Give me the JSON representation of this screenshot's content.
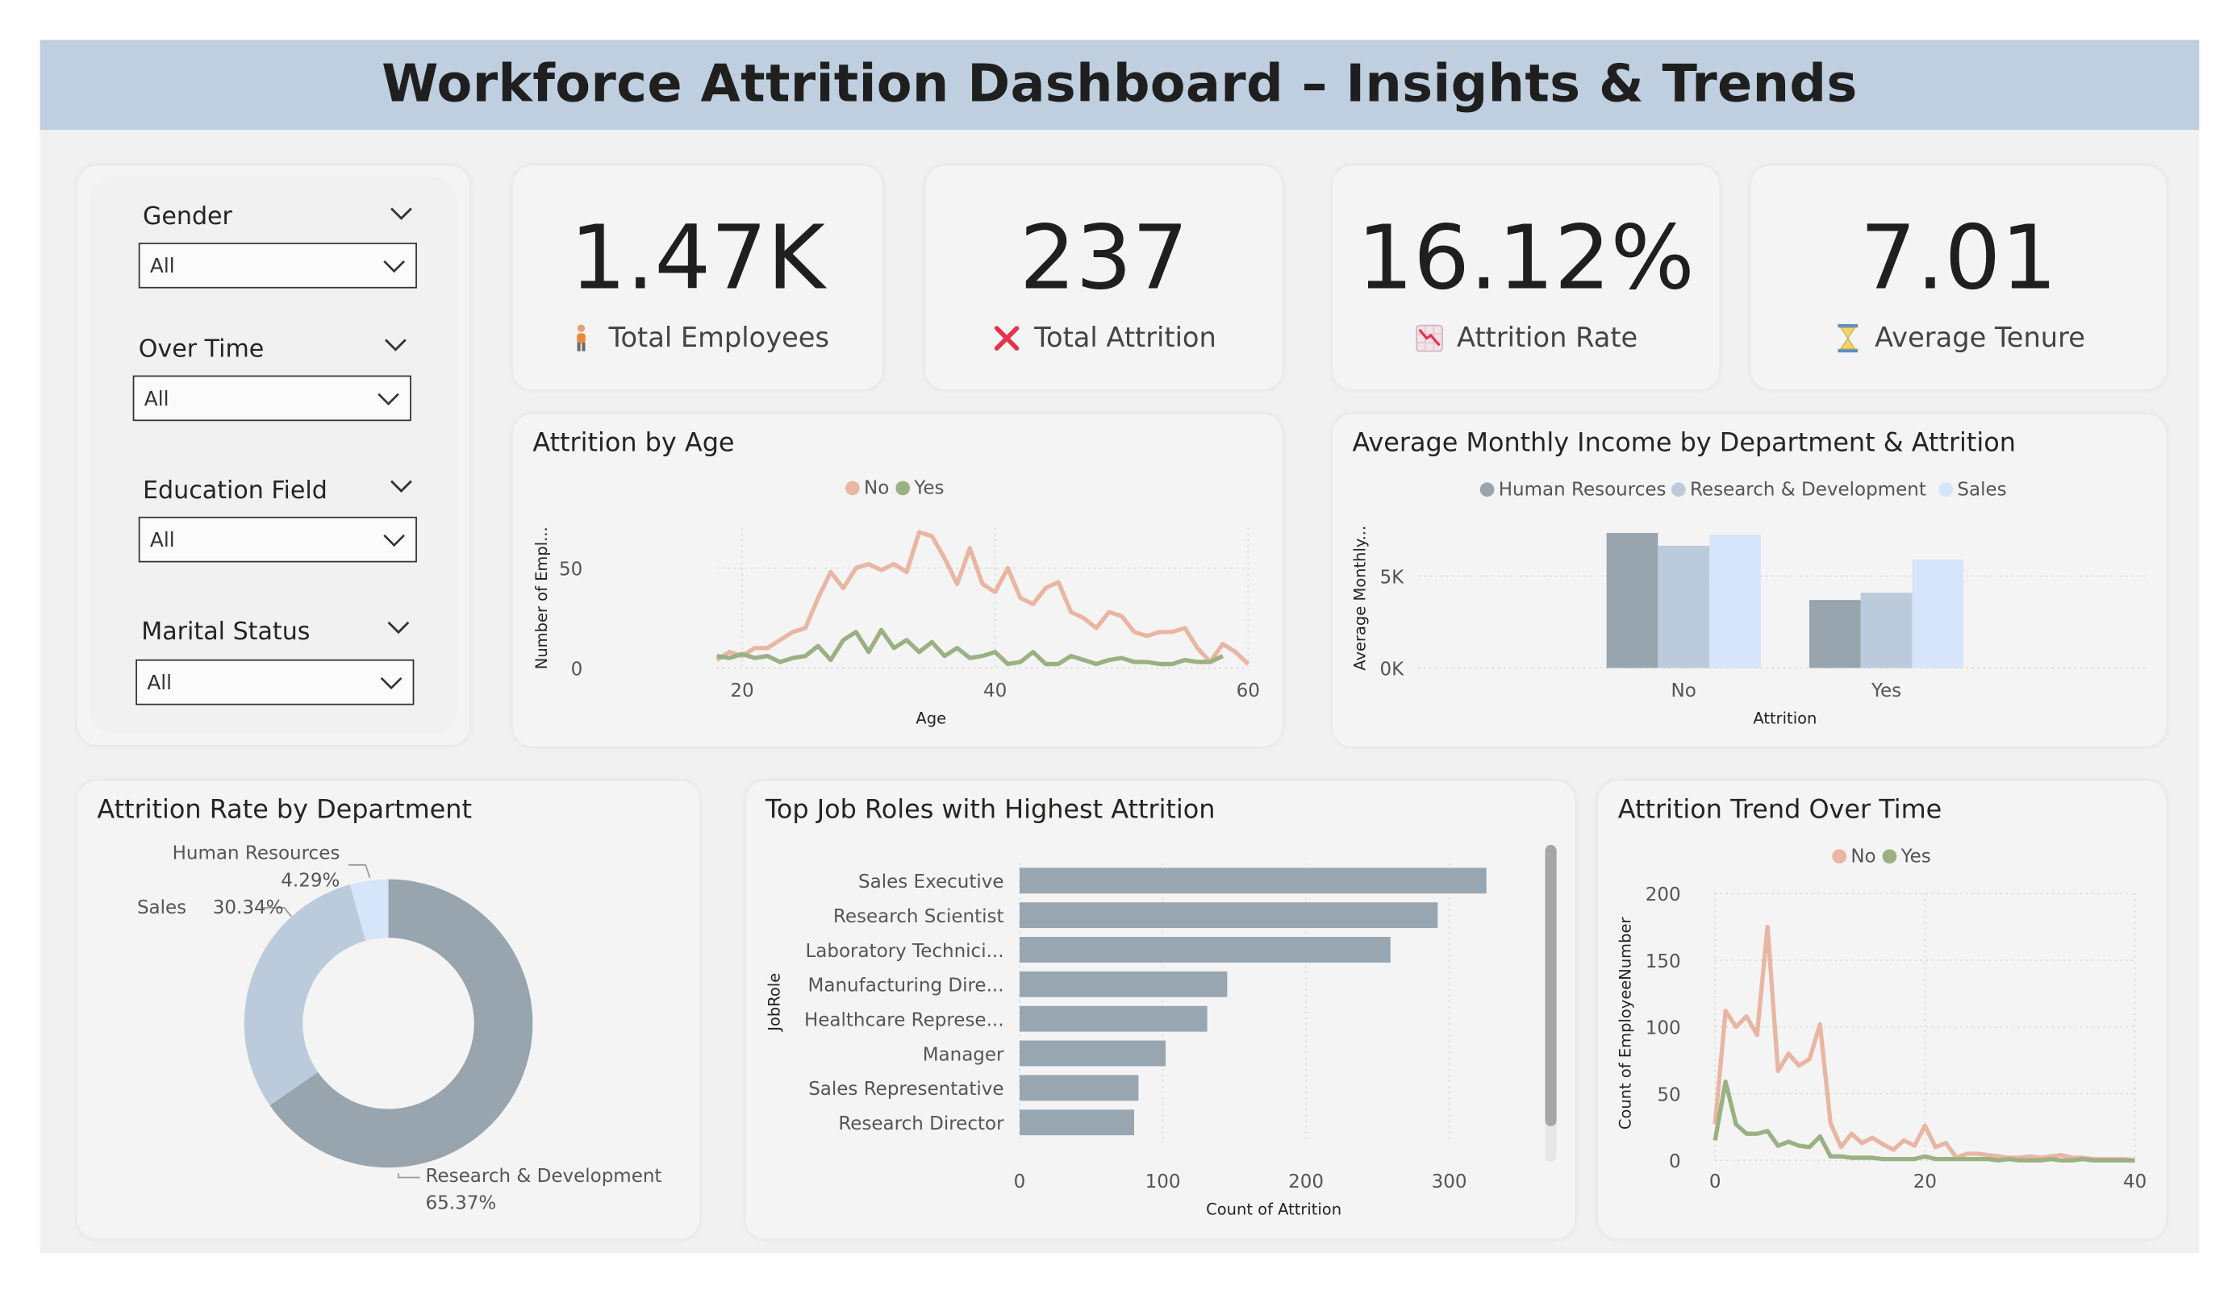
{
  "title": "Workforce Attrition Dashboard – Insights & Trends",
  "slicers": [
    {
      "label": "Gender",
      "value": "All"
    },
    {
      "label": "Over Time",
      "value": "All"
    },
    {
      "label": "Education Field",
      "value": "All"
    },
    {
      "label": "Marital Status",
      "value": "All"
    }
  ],
  "kpis": [
    {
      "value": "1.47K",
      "label": "Total Employees",
      "icon": "person-icon"
    },
    {
      "value": "237",
      "label": "Total Attrition",
      "icon": "cross-icon"
    },
    {
      "value": "16.12%",
      "label": "Attrition Rate",
      "icon": "chart-down-icon"
    },
    {
      "value": "7.01",
      "label": "Average Tenure",
      "icon": "hourglass-icon"
    }
  ],
  "colors": {
    "no": "#e8b6a2",
    "yes": "#9bb083",
    "hr": "#98a4ae",
    "rnd": "#bccbdb",
    "sales": "#d6e5f9",
    "bar": "#98a6b1",
    "cross": "#e6324b"
  },
  "chart_data": [
    {
      "id": "age",
      "type": "line",
      "title": "Attrition by Age",
      "xlabel": "Age",
      "ylabel": "Number of Empl...",
      "xlim": [
        18,
        60
      ],
      "ylim": [
        0,
        70
      ],
      "xticks": [
        "20",
        "40",
        "60"
      ],
      "yticks": [
        "0",
        "50"
      ],
      "legend": "top",
      "series": [
        {
          "name": "No",
          "color": "#e8b6a2",
          "x": [
            18,
            19,
            20,
            21,
            22,
            23,
            24,
            25,
            26,
            27,
            28,
            29,
            30,
            31,
            32,
            33,
            34,
            35,
            36,
            37,
            38,
            39,
            40,
            41,
            42,
            43,
            44,
            45,
            46,
            47,
            48,
            49,
            50,
            51,
            52,
            53,
            54,
            55,
            56,
            57,
            58,
            59,
            60
          ],
          "y": [
            4,
            8,
            6,
            10,
            10,
            14,
            18,
            20,
            35,
            48,
            40,
            50,
            52,
            49,
            52,
            48,
            68,
            66,
            55,
            42,
            60,
            42,
            38,
            50,
            35,
            32,
            40,
            43,
            28,
            25,
            20,
            28,
            26,
            18,
            16,
            18,
            18,
            20,
            10,
            3,
            12,
            8,
            2
          ]
        },
        {
          "name": "Yes",
          "color": "#9bb083",
          "x": [
            18,
            19,
            20,
            21,
            22,
            23,
            24,
            25,
            26,
            27,
            28,
            29,
            30,
            31,
            32,
            33,
            34,
            35,
            36,
            37,
            38,
            39,
            40,
            41,
            42,
            43,
            44,
            45,
            46,
            47,
            48,
            49,
            50,
            51,
            52,
            53,
            54,
            55,
            56,
            57,
            58
          ],
          "y": [
            6,
            5,
            7,
            5,
            6,
            3,
            5,
            6,
            11,
            4,
            14,
            18,
            8,
            19,
            10,
            14,
            8,
            13,
            6,
            10,
            5,
            6,
            8,
            2,
            3,
            8,
            2,
            2,
            6,
            4,
            2,
            4,
            5,
            3,
            3,
            2,
            2,
            4,
            3,
            3,
            6
          ]
        }
      ]
    },
    {
      "id": "income",
      "type": "bar",
      "title": "Average Monthly Income by Department & Attrition",
      "xlabel": "Attrition",
      "ylabel": "Average Monthly...",
      "categories": [
        "No",
        "Yes"
      ],
      "ylim": [
        0,
        8000
      ],
      "yticks": [
        "0K",
        "5K"
      ],
      "legend": "top",
      "series": [
        {
          "name": "Human Resources",
          "color": "#98a4ae",
          "values": [
            7350,
            3700
          ]
        },
        {
          "name": "Research & Development",
          "color": "#bccbdb",
          "values": [
            6650,
            4100
          ]
        },
        {
          "name": "Sales",
          "color": "#d6e5f9",
          "values": [
            7250,
            5900
          ]
        }
      ]
    },
    {
      "id": "dept",
      "type": "pie",
      "title": "Attrition Rate by Department",
      "slices": [
        {
          "name": "Research & Development",
          "value": 65.37,
          "label": "65.37%",
          "color": "#98a4ae"
        },
        {
          "name": "Sales",
          "value": 30.34,
          "label": "30.34%",
          "color": "#bccbdb"
        },
        {
          "name": "Human Resources",
          "value": 4.29,
          "label": "4.29%",
          "color": "#d6e5f9"
        }
      ]
    },
    {
      "id": "roles",
      "type": "bar",
      "orientation": "horizontal",
      "title": "Top Job Roles with Highest Attrition",
      "xlabel": "Count of Attrition",
      "ylabel": "JobRole",
      "xlim": [
        0,
        360
      ],
      "xticks": [
        "0",
        "100",
        "200",
        "300"
      ],
      "categories": [
        "Sales Executive",
        "Research Scientist",
        "Laboratory Technici...",
        "Manufacturing Dire...",
        "Healthcare Represe...",
        "Manager",
        "Sales Representative",
        "Research Director"
      ],
      "values": [
        326,
        292,
        259,
        145,
        131,
        102,
        83,
        80
      ]
    },
    {
      "id": "trend",
      "type": "line",
      "title": "Attrition Trend Over Time",
      "xlabel": "",
      "ylabel": "Count of EmployeeNumber",
      "xlim": [
        0,
        40
      ],
      "ylim": [
        0,
        200
      ],
      "xticks": [
        "0",
        "20",
        "40"
      ],
      "yticks": [
        "0",
        "50",
        "100",
        "150",
        "200"
      ],
      "legend": "top",
      "series": [
        {
          "name": "No",
          "color": "#e8b6a2",
          "x": [
            0,
            1,
            2,
            3,
            4,
            5,
            6,
            7,
            8,
            9,
            10,
            11,
            12,
            13,
            14,
            15,
            16,
            17,
            18,
            19,
            20,
            21,
            22,
            23,
            24,
            25,
            26,
            27,
            28,
            29,
            30,
            31,
            32,
            33,
            34,
            35,
            36,
            37,
            38,
            39,
            40
          ],
          "y": [
            27,
            112,
            100,
            108,
            94,
            175,
            67,
            80,
            71,
            76,
            102,
            28,
            10,
            20,
            13,
            17,
            12,
            8,
            15,
            11,
            26,
            10,
            13,
            2,
            5,
            5,
            4,
            3,
            2,
            2,
            3,
            2,
            3,
            4,
            2,
            2,
            1,
            1,
            1,
            1,
            0
          ]
        },
        {
          "name": "Yes",
          "color": "#9bb083",
          "x": [
            0,
            1,
            2,
            3,
            4,
            5,
            6,
            7,
            8,
            9,
            10,
            11,
            12,
            13,
            14,
            15,
            16,
            17,
            18,
            19,
            20,
            21,
            22,
            23,
            24,
            25,
            26,
            27,
            28,
            29,
            30,
            31,
            32,
            33,
            34,
            35,
            36,
            37,
            38,
            39,
            40
          ],
          "y": [
            15,
            59,
            27,
            20,
            20,
            22,
            11,
            14,
            11,
            10,
            18,
            3,
            3,
            2,
            2,
            2,
            1,
            1,
            1,
            1,
            3,
            1,
            1,
            1,
            1,
            1,
            1,
            0,
            1,
            0,
            0,
            0,
            1,
            0,
            0,
            1,
            0,
            0,
            0,
            0,
            0
          ]
        }
      ]
    }
  ]
}
